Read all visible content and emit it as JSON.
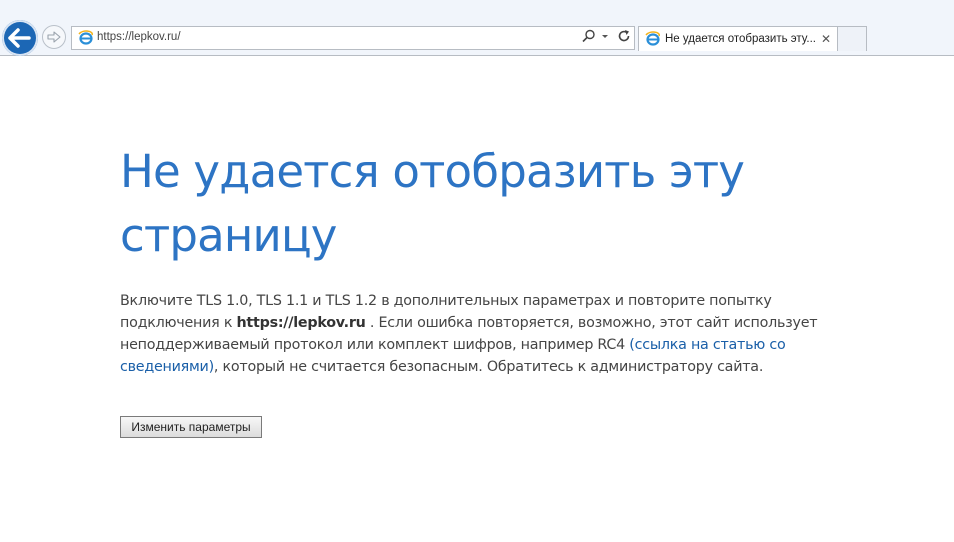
{
  "browser": {
    "url": "https://lepkov.ru/",
    "tab_title": "Не удается отобразить эту...",
    "tab_close": "✕"
  },
  "page": {
    "title": "Не удается отобразить эту страницу",
    "text_part1": "Включите TLS 1.0, TLS 1.1 и TLS 1.2 в дополнительных параметрах и повторите попытку подключения к ",
    "host": "https://lepkov.ru",
    "text_part2": " . Если ошибка повторяется, возможно, этот сайт использует неподдерживаемый протокол или комплект шифров, например RC4 ",
    "link_text": "(ссылка на статью со сведениями)",
    "text_part3": ", который не считается безопасным. Обратитесь к администратору сайта.",
    "button_label": "Изменить параметры"
  },
  "colors": {
    "title": "#2d74c4",
    "back_button": "#1c67b5",
    "link": "#1a5fa8"
  },
  "icons": [
    "back-arrow-icon",
    "forward-arrow-icon",
    "ie-icon",
    "search-icon",
    "dropdown-icon",
    "refresh-icon",
    "close-icon"
  ]
}
